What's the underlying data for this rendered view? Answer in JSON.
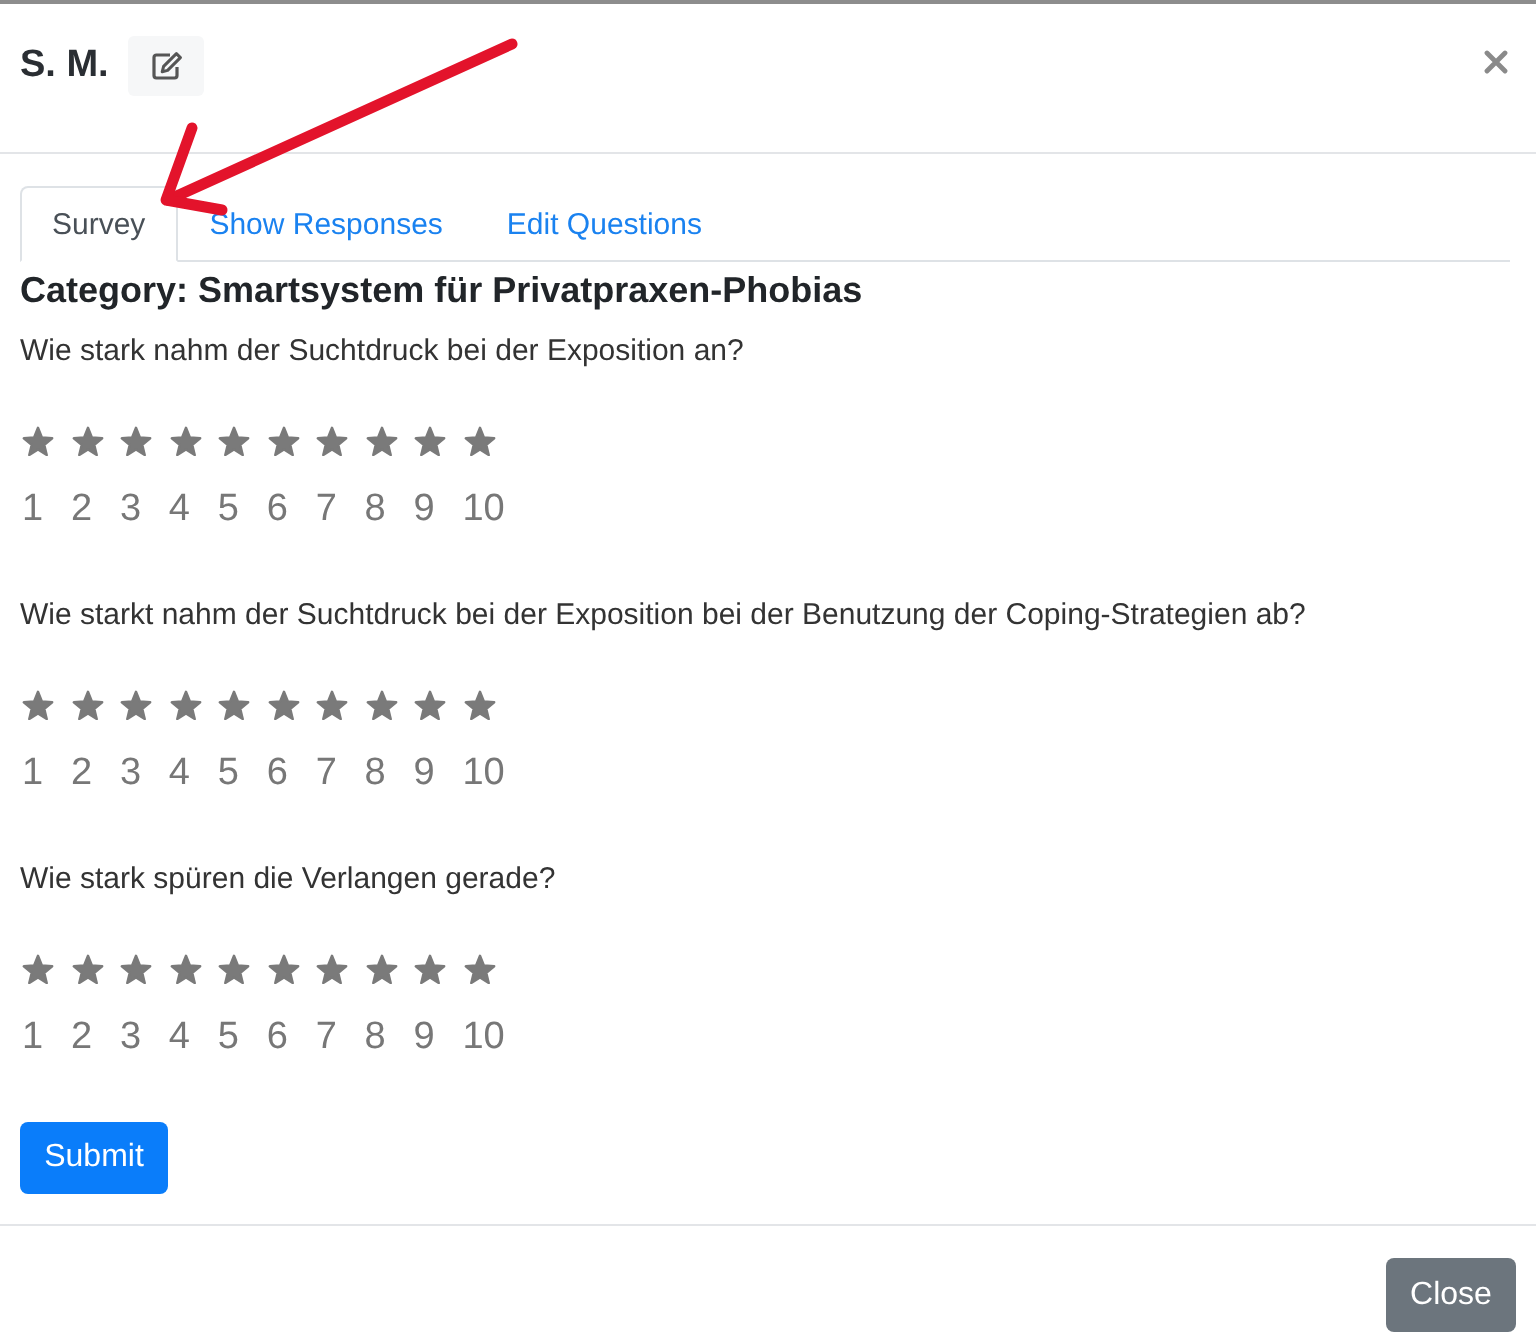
{
  "header": {
    "title": "S. M."
  },
  "tabs": [
    {
      "label": "Survey",
      "selected": true
    },
    {
      "label": "Show Responses",
      "selected": false
    },
    {
      "label": "Edit Questions",
      "selected": false
    }
  ],
  "category": "Category: Smartsystem für Privatpraxen-Phobias",
  "questions": [
    {
      "text": "Wie stark nahm der Suchtdruck bei der Exposition an?",
      "stars": 10,
      "scale": [
        "1",
        "2",
        "3",
        "4",
        "5",
        "6",
        "7",
        "8",
        "9",
        "10"
      ]
    },
    {
      "text": "Wie starkt nahm der Suchtdruck bei der Exposition bei der Benutzung der Coping-Strategien ab?",
      "stars": 10,
      "scale": [
        "1",
        "2",
        "3",
        "4",
        "5",
        "6",
        "7",
        "8",
        "9",
        "10"
      ]
    },
    {
      "text": "Wie stark spüren die Verlangen gerade?",
      "stars": 10,
      "scale": [
        "1",
        "2",
        "3",
        "4",
        "5",
        "6",
        "7",
        "8",
        "9",
        "10"
      ]
    }
  ],
  "submit_button": "Submit",
  "footer": {
    "close_button": "Close"
  },
  "annotations": [
    {
      "kind": "arrow"
    }
  ]
}
